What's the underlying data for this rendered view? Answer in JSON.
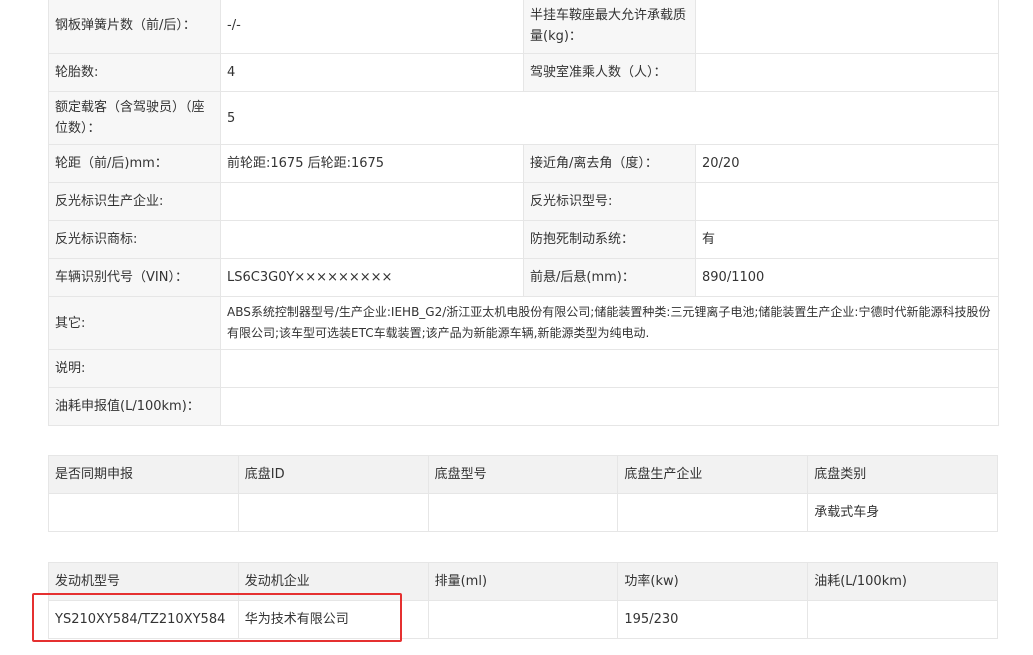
{
  "spec_rows": [
    {
      "label1": "钢板弹簧片数（前/后）：",
      "value1": "-/-",
      "label2": "半挂车鞍座最大允许承载质量(kg)：",
      "value2": ""
    },
    {
      "label1": "轮胎数:",
      "value1": "4",
      "label2": "驾驶室准乘人数（人）：",
      "value2": ""
    },
    {
      "label1": "额定载客（含驾驶员）（座位数）：",
      "value1": "5"
    },
    {
      "label1": "轮距（前/后)mm：",
      "value1": "前轮距:1675 后轮距:1675",
      "label2": "接近角/离去角（度）：",
      "value2": "20/20"
    },
    {
      "label1": "反光标识生产企业:",
      "value1": "",
      "label2": "反光标识型号:",
      "value2": ""
    },
    {
      "label1": "反光标识商标:",
      "value1": "",
      "label2": "防抱死制动系统：",
      "value2": "有"
    },
    {
      "label1": "车辆识别代号（VIN）：",
      "value1": "LS6C3G0Y×××××××××",
      "label2": "前悬/后悬(mm)：",
      "value2": "890/1100"
    },
    {
      "label1": "其它:",
      "value1": "ABS系统控制器型号/生产企业:IEHB_G2/浙江亚太机电股份有限公司;储能装置种类:三元锂离子电池;储能装置生产企业:宁德时代新能源科技股份有限公司;该车型可选装ETC车载装置;该产品为新能源车辆,新能源类型为纯电动."
    },
    {
      "label1": "说明:",
      "value1": ""
    },
    {
      "label1": "油耗申报值(L/100km)：",
      "value1": ""
    }
  ],
  "chassis": {
    "headers": [
      "是否同期申报",
      "底盘ID",
      "底盘型号",
      "底盘生产企业",
      "底盘类别"
    ],
    "row": [
      "",
      "",
      "",
      "",
      "承载式车身"
    ]
  },
  "engine": {
    "headers": [
      "发动机型号",
      "发动机企业",
      "排量(ml)",
      "功率(kw)",
      "油耗(L/100km)"
    ],
    "row": [
      "YS210XY584/TZ210XY584",
      "华为技术有限公司",
      "",
      "195/230",
      ""
    ]
  },
  "colors": {
    "highlight": "#e53030",
    "label_bg": "#f7f7f7",
    "header_bg": "#f2f2f2",
    "border": "#e6e6e6"
  }
}
